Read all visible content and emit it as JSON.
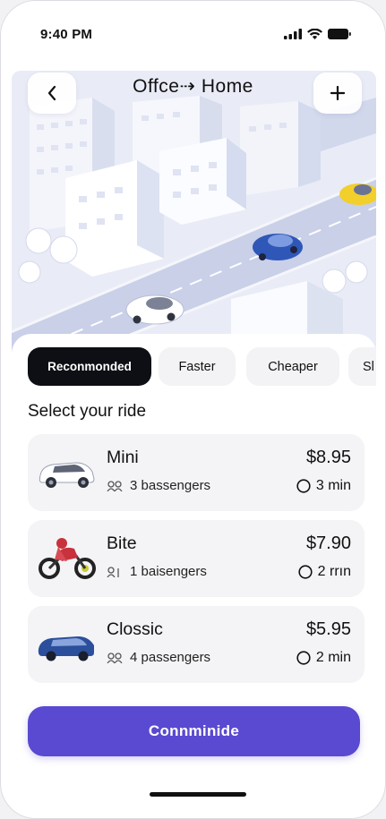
{
  "status_bar": {
    "time": "9:40 PM"
  },
  "header": {
    "route_title": "Offce⇢ Home"
  },
  "tabs": [
    {
      "label": "Reconmonded",
      "active": true
    },
    {
      "label": "Faster",
      "active": false
    },
    {
      "label": "Cheaper",
      "active": false
    },
    {
      "label": "Sl",
      "active": false
    }
  ],
  "section_title": "Select your ride",
  "rides": [
    {
      "name": "Mini",
      "passengers": "3 bassengers",
      "price": "$8.95",
      "eta": "3 min",
      "vehicle_icon": "white-car"
    },
    {
      "name": "Bite",
      "passengers": "1 baisengers",
      "price": "$7.90",
      "eta": "2 rrın",
      "vehicle_icon": "red-motorbike"
    },
    {
      "name": "Clossic",
      "passengers": "4 passengers",
      "price": "$5.95",
      "eta": "2 min",
      "vehicle_icon": "blue-car"
    }
  ],
  "cta": {
    "label": "Connminide"
  },
  "colors": {
    "accent": "#5a49d1",
    "active_tab": "#0d0f14",
    "card_bg": "#f4f4f6"
  }
}
